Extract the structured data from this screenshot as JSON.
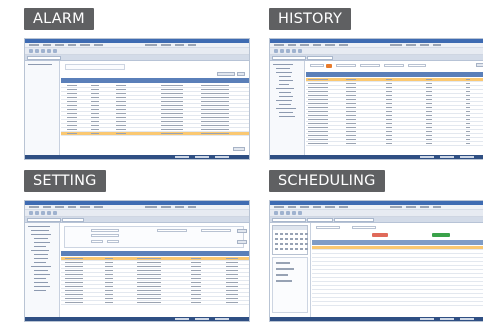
{
  "panels": {
    "alarm": {
      "label": "ALARM"
    },
    "history": {
      "label": "HISTORY"
    },
    "setting": {
      "label": "SETTING"
    },
    "scheduling": {
      "label": "SCHEDULING"
    }
  },
  "colors": {
    "tag_bg": "#5f6062",
    "tag_text": "#ffffff",
    "app_titlebar": "#3e6bb2",
    "grid_header": "#5a7fb9",
    "row_highlight": "#fac872",
    "status_bar": "#2f4f83",
    "schedule_red": "#e06a5a",
    "schedule_green": "#3aa24a"
  }
}
